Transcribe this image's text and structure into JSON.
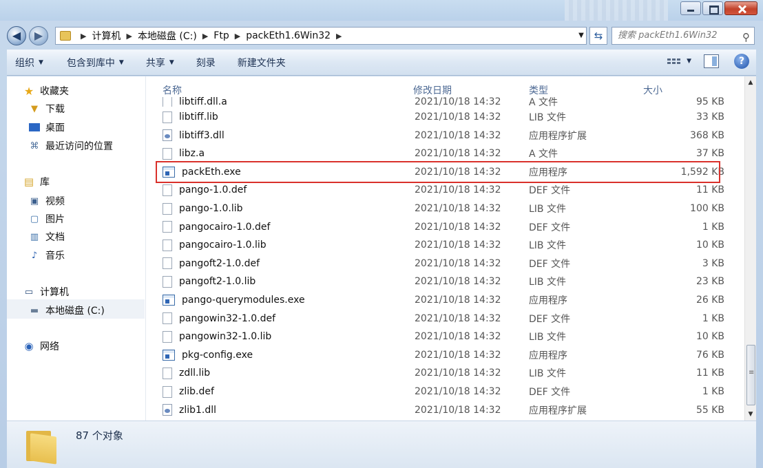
{
  "window": {
    "minimize_icon": "minimize-icon",
    "maximize_icon": "maximize-icon",
    "close_icon": "close-icon"
  },
  "address_bar": {
    "crumbs": [
      "计算机",
      "本地磁盘 (C:)",
      "Ftp",
      "packEth1.6Win32"
    ],
    "separator": "▶",
    "dropdown": "▼",
    "refresh": "⇆"
  },
  "search": {
    "placeholder": "搜索 packEth1.6Win32",
    "icon": "⚲"
  },
  "toolbar": {
    "organize": "组织",
    "include_in_library": "包含到库中",
    "share": "共享",
    "burn": "刻录",
    "new_folder": "新建文件夹",
    "dropdown_arrow": "▼",
    "help": "?"
  },
  "nav": {
    "favorites": "收藏夹",
    "downloads": "下载",
    "desktop": "桌面",
    "recent": "最近访问的位置",
    "libraries": "库",
    "videos": "视频",
    "pictures": "图片",
    "documents": "文档",
    "music": "音乐",
    "computer": "计算机",
    "local_disk": "本地磁盘 (C:)",
    "network": "网络"
  },
  "columns": {
    "name": "名称",
    "date": "修改日期",
    "type": "类型",
    "size": "大小"
  },
  "files": [
    {
      "name": "libtiff.dll.a",
      "date": "2021/10/18 14:32",
      "type": "A 文件",
      "size": "95 KB",
      "icon": "file"
    },
    {
      "name": "libtiff.lib",
      "date": "2021/10/18 14:32",
      "type": "LIB 文件",
      "size": "33 KB",
      "icon": "file"
    },
    {
      "name": "libtiff3.dll",
      "date": "2021/10/18 14:32",
      "type": "应用程序扩展",
      "size": "368 KB",
      "icon": "dll"
    },
    {
      "name": "libz.a",
      "date": "2021/10/18 14:32",
      "type": "A 文件",
      "size": "37 KB",
      "icon": "file"
    },
    {
      "name": "packEth.exe",
      "date": "2021/10/18 14:32",
      "type": "应用程序",
      "size": "1,592 KB",
      "icon": "exe"
    },
    {
      "name": "pango-1.0.def",
      "date": "2021/10/18 14:32",
      "type": "DEF 文件",
      "size": "11 KB",
      "icon": "file"
    },
    {
      "name": "pango-1.0.lib",
      "date": "2021/10/18 14:32",
      "type": "LIB 文件",
      "size": "100 KB",
      "icon": "file"
    },
    {
      "name": "pangocairo-1.0.def",
      "date": "2021/10/18 14:32",
      "type": "DEF 文件",
      "size": "1 KB",
      "icon": "file"
    },
    {
      "name": "pangocairo-1.0.lib",
      "date": "2021/10/18 14:32",
      "type": "LIB 文件",
      "size": "10 KB",
      "icon": "file"
    },
    {
      "name": "pangoft2-1.0.def",
      "date": "2021/10/18 14:32",
      "type": "DEF 文件",
      "size": "3 KB",
      "icon": "file"
    },
    {
      "name": "pangoft2-1.0.lib",
      "date": "2021/10/18 14:32",
      "type": "LIB 文件",
      "size": "23 KB",
      "icon": "file"
    },
    {
      "name": "pango-querymodules.exe",
      "date": "2021/10/18 14:32",
      "type": "应用程序",
      "size": "26 KB",
      "icon": "exe"
    },
    {
      "name": "pangowin32-1.0.def",
      "date": "2021/10/18 14:32",
      "type": "DEF 文件",
      "size": "1 KB",
      "icon": "file"
    },
    {
      "name": "pangowin32-1.0.lib",
      "date": "2021/10/18 14:32",
      "type": "LIB 文件",
      "size": "10 KB",
      "icon": "file"
    },
    {
      "name": "pkg-config.exe",
      "date": "2021/10/18 14:32",
      "type": "应用程序",
      "size": "76 KB",
      "icon": "exe"
    },
    {
      "name": "zdll.lib",
      "date": "2021/10/18 14:32",
      "type": "LIB 文件",
      "size": "11 KB",
      "icon": "file"
    },
    {
      "name": "zlib.def",
      "date": "2021/10/18 14:32",
      "type": "DEF 文件",
      "size": "1 KB",
      "icon": "file"
    },
    {
      "name": "zlib1.dll",
      "date": "2021/10/18 14:32",
      "type": "应用程序扩展",
      "size": "55 KB",
      "icon": "dll"
    }
  ],
  "highlighted_file": "packEth.exe",
  "highlight_color": "#d9302a",
  "status": {
    "count": "87 个对象"
  }
}
